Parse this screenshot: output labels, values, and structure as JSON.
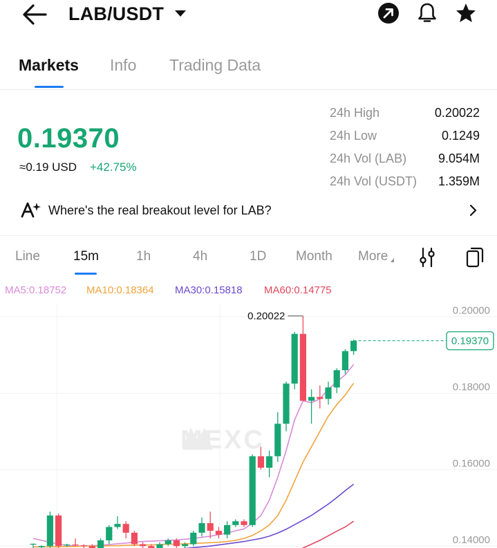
{
  "header": {
    "pair": "LAB/USDT",
    "icons": [
      "back-arrow-icon",
      "caret-down-icon",
      "share-arrow-icon",
      "bell-icon",
      "star-icon"
    ]
  },
  "tabs": [
    {
      "label": "Markets",
      "active": true
    },
    {
      "label": "Info",
      "active": false
    },
    {
      "label": "Trading Data",
      "active": false
    }
  ],
  "ticker": {
    "last_price": "0.19370",
    "usd_equiv": "≈0.19 USD",
    "change": "+42.75%",
    "stats": [
      {
        "label": "24h High",
        "value": "0.20022"
      },
      {
        "label": "24h Low",
        "value": "0.1249"
      },
      {
        "label": "24h Vol (LAB)",
        "value": "9.054M"
      },
      {
        "label": "24h Vol (USDT)",
        "value": "1.359M"
      }
    ]
  },
  "insight": {
    "text": "Where's the real breakout level for LAB?"
  },
  "intervals": [
    {
      "label": "Line",
      "active": false
    },
    {
      "label": "15m",
      "active": true
    },
    {
      "label": "1h",
      "active": false
    },
    {
      "label": "4h",
      "active": false
    },
    {
      "label": "1D",
      "active": false
    },
    {
      "label": "Month",
      "active": false
    },
    {
      "label": "More",
      "active": false
    }
  ],
  "moving_averages": [
    {
      "label": "MA5:0.18752",
      "color": "#d98ad9"
    },
    {
      "label": "MA10:0.18364",
      "color": "#f0a33c"
    },
    {
      "label": "MA30:0.15818",
      "color": "#6a4ad1"
    },
    {
      "label": "MA60:0.14775",
      "color": "#e0485d"
    }
  ],
  "colors": {
    "up": "#17a673",
    "down": "#ef4d5f",
    "accent": "#1c7cf3"
  },
  "chart_data": {
    "type": "candlestick",
    "y_ticks": [
      "0.20000",
      "0.18000",
      "0.16000",
      "0.14000"
    ],
    "y_tick_values": [
      0.2,
      0.18,
      0.16,
      0.14
    ],
    "high_label": "0.20022",
    "last_price_label": "0.19370",
    "watermark": "MEXC",
    "candles": [
      {
        "o": 0.1405,
        "h": 0.1407,
        "l": 0.1395,
        "c": 0.1406
      },
      {
        "o": 0.1397,
        "h": 0.1402,
        "l": 0.139,
        "c": 0.14
      },
      {
        "o": 0.14,
        "h": 0.149,
        "l": 0.1395,
        "c": 0.148
      },
      {
        "o": 0.148,
        "h": 0.1485,
        "l": 0.1395,
        "c": 0.14
      },
      {
        "o": 0.1402,
        "h": 0.1406,
        "l": 0.1398,
        "c": 0.1404
      },
      {
        "o": 0.1404,
        "h": 0.142,
        "l": 0.14,
        "c": 0.1402
      },
      {
        "o": 0.1402,
        "h": 0.1405,
        "l": 0.1395,
        "c": 0.14
      },
      {
        "o": 0.14,
        "h": 0.1405,
        "l": 0.139,
        "c": 0.1395
      },
      {
        "o": 0.1395,
        "h": 0.142,
        "l": 0.139,
        "c": 0.1415
      },
      {
        "o": 0.1415,
        "h": 0.1455,
        "l": 0.1405,
        "c": 0.145
      },
      {
        "o": 0.145,
        "h": 0.1478,
        "l": 0.1445,
        "c": 0.1458
      },
      {
        "o": 0.1458,
        "h": 0.1465,
        "l": 0.142,
        "c": 0.1435
      },
      {
        "o": 0.1435,
        "h": 0.144,
        "l": 0.14,
        "c": 0.1405
      },
      {
        "o": 0.1405,
        "h": 0.141,
        "l": 0.1395,
        "c": 0.14
      },
      {
        "o": 0.14,
        "h": 0.1405,
        "l": 0.139,
        "c": 0.1395
      },
      {
        "o": 0.1395,
        "h": 0.141,
        "l": 0.139,
        "c": 0.1405
      },
      {
        "o": 0.1405,
        "h": 0.142,
        "l": 0.14,
        "c": 0.1415
      },
      {
        "o": 0.1415,
        "h": 0.142,
        "l": 0.1395,
        "c": 0.14
      },
      {
        "o": 0.14,
        "h": 0.141,
        "l": 0.1395,
        "c": 0.1405
      },
      {
        "o": 0.1405,
        "h": 0.144,
        "l": 0.14,
        "c": 0.1435
      },
      {
        "o": 0.1435,
        "h": 0.1475,
        "l": 0.1425,
        "c": 0.146
      },
      {
        "o": 0.146,
        "h": 0.149,
        "l": 0.142,
        "c": 0.144
      },
      {
        "o": 0.144,
        "h": 0.145,
        "l": 0.142,
        "c": 0.143
      },
      {
        "o": 0.143,
        "h": 0.1465,
        "l": 0.142,
        "c": 0.1455
      },
      {
        "o": 0.1455,
        "h": 0.147,
        "l": 0.145,
        "c": 0.1465
      },
      {
        "o": 0.1465,
        "h": 0.147,
        "l": 0.145,
        "c": 0.1455
      },
      {
        "o": 0.1455,
        "h": 0.164,
        "l": 0.145,
        "c": 0.1635
      },
      {
        "o": 0.1635,
        "h": 0.166,
        "l": 0.16,
        "c": 0.1605
      },
      {
        "o": 0.1605,
        "h": 0.165,
        "l": 0.158,
        "c": 0.1635
      },
      {
        "o": 0.1635,
        "h": 0.175,
        "l": 0.162,
        "c": 0.172
      },
      {
        "o": 0.172,
        "h": 0.183,
        "l": 0.17,
        "c": 0.1825
      },
      {
        "o": 0.1825,
        "h": 0.196,
        "l": 0.181,
        "c": 0.1955
      },
      {
        "o": 0.1955,
        "h": 0.2002,
        "l": 0.178,
        "c": 0.178
      },
      {
        "o": 0.178,
        "h": 0.181,
        "l": 0.172,
        "c": 0.179
      },
      {
        "o": 0.179,
        "h": 0.182,
        "l": 0.176,
        "c": 0.1785
      },
      {
        "o": 0.1785,
        "h": 0.183,
        "l": 0.177,
        "c": 0.1815
      },
      {
        "o": 0.1815,
        "h": 0.1865,
        "l": 0.18,
        "c": 0.186
      },
      {
        "o": 0.186,
        "h": 0.1915,
        "l": 0.185,
        "c": 0.191
      },
      {
        "o": 0.191,
        "h": 0.194,
        "l": 0.19,
        "c": 0.1937
      }
    ],
    "ma_lines": [
      {
        "name": "MA5",
        "values": [
          0.142,
          0.1415,
          0.141,
          0.1405,
          0.1402,
          0.14,
          0.14,
          0.1401,
          0.1402,
          0.1404,
          0.1406,
          0.1408,
          0.141,
          0.1412,
          0.1413,
          0.1414,
          0.1415,
          0.1416,
          0.1418,
          0.142,
          0.1423,
          0.1426,
          0.143,
          0.1434,
          0.144,
          0.1445,
          0.146,
          0.148,
          0.152,
          0.158,
          0.165,
          0.173,
          0.178,
          0.1775,
          0.1785,
          0.181,
          0.183,
          0.1848,
          0.1875
        ]
      },
      {
        "name": "MA10",
        "values": [
          0.1398,
          0.1398,
          0.1398,
          0.1398,
          0.1399,
          0.1399,
          0.14,
          0.14,
          0.14,
          0.1401,
          0.1401,
          0.1402,
          0.1402,
          0.1403,
          0.1403,
          0.1404,
          0.1405,
          0.1405,
          0.1406,
          0.1407,
          0.1408,
          0.1409,
          0.141,
          0.1412,
          0.1415,
          0.142,
          0.1428,
          0.144,
          0.1455,
          0.148,
          0.152,
          0.157,
          0.162,
          0.166,
          0.17,
          0.174,
          0.177,
          0.1795,
          0.1826
        ]
      },
      {
        "name": "MA30",
        "values": [
          null,
          null,
          null,
          null,
          null,
          null,
          null,
          null,
          null,
          null,
          null,
          null,
          null,
          null,
          null,
          null,
          0.139,
          0.1392,
          0.1394,
          0.1396,
          0.1398,
          0.14,
          0.1403,
          0.1406,
          0.1409,
          0.1412,
          0.1416,
          0.142,
          0.1426,
          0.1434,
          0.1444,
          0.1456,
          0.1468,
          0.148,
          0.1495,
          0.151,
          0.1527,
          0.1545,
          0.1562
        ]
      },
      {
        "name": "MA60",
        "values": [
          null,
          null,
          null,
          null,
          null,
          null,
          null,
          null,
          null,
          null,
          null,
          null,
          null,
          null,
          null,
          null,
          null,
          null,
          null,
          null,
          null,
          null,
          null,
          null,
          null,
          null,
          null,
          null,
          null,
          null,
          0.1375,
          0.1385,
          0.1395,
          0.1405,
          0.1415,
          0.1427,
          0.1439,
          0.145,
          0.1465
        ]
      }
    ],
    "ylim": [
      0.1395,
      0.2032
    ]
  }
}
